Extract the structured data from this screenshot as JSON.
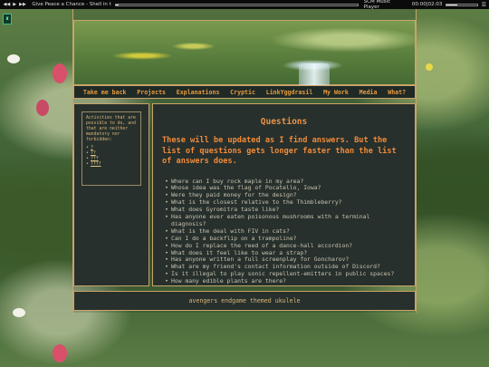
{
  "music_player": {
    "prev_icon": "prev-icon",
    "play_icon": "play-icon",
    "next_icon": "next-icon",
    "track_title": "Give Peace a Chance - Shell in the Pit",
    "player_name": "SCM Music Player",
    "time": "00:00|02:03",
    "progress": 0.01,
    "volume": 0.35
  },
  "nav": {
    "items": [
      {
        "label": "Take me back"
      },
      {
        "label": "Projects"
      },
      {
        "label": "Explanations"
      },
      {
        "label": "Cryptic"
      },
      {
        "label": "LinkYggdrasil"
      },
      {
        "label": "My Work"
      },
      {
        "label": "Media"
      },
      {
        "label": "What?"
      }
    ]
  },
  "sidebar": {
    "text": "Activities that are possible to do, and that are neither mandatory nor forbidden:",
    "links": [
      "?",
      "??",
      "???",
      "????"
    ]
  },
  "main": {
    "title": "Questions",
    "intro": "These will be updated as I find answers. But the list of questions gets longer faster than the list of answers does.",
    "questions": [
      "Where can I buy rock maple in my area?",
      "Whose idea was the flag of Pocatello, Iowa?",
      "Were they paid money for the design?",
      "What is the closest relative to the Thimbleberry?",
      "What does Gyromitra taste like?",
      "Has anyone ever eaten poisonous mushrooms with a terminal diagnosis?",
      "What is the deal with FIV in cats?",
      "Can I do a backflip on a trampoline?",
      "How do I replace the reed of a dance-hall accordion?",
      "What does it feel like to wear a strap?",
      "Has anyone written a full screenplay for Goncharov?",
      "What are my friend's contact information outside of Discord?",
      "Is it illegal to play sonic repellent-emitters in public spaces?",
      "How many edible plants are there?"
    ]
  },
  "footer": {
    "text": "avengers endgame themed ukulele"
  },
  "colors": {
    "accent": "#e8934a",
    "border": "#c8a46a",
    "panel": "#27302c"
  }
}
